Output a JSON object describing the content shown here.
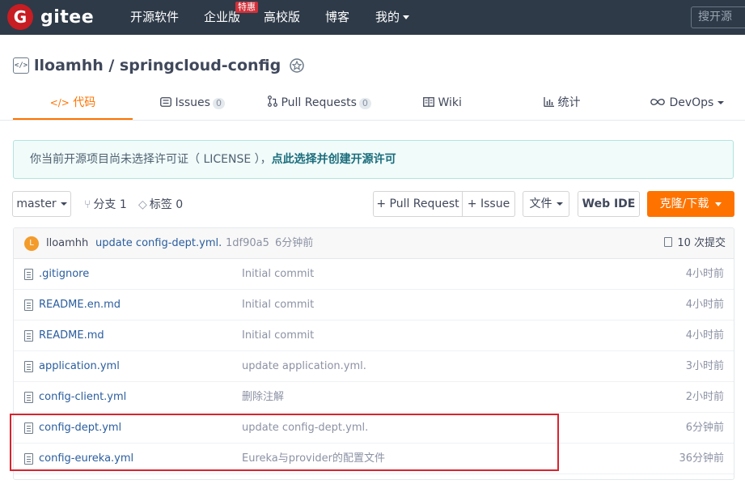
{
  "topnav": {
    "logo_mark": "G",
    "logo_text": "gitee",
    "items": [
      {
        "label": "开源软件"
      },
      {
        "label": "企业版",
        "badge": "特惠"
      },
      {
        "label": "高校版"
      },
      {
        "label": "博客"
      },
      {
        "label": "我的"
      }
    ],
    "search_text": "搜开源"
  },
  "repo": {
    "code_icon": "</>",
    "title": "lloamhh / springcloud-config"
  },
  "tabs": [
    {
      "icon": "</>",
      "label": "代码",
      "active": true
    },
    {
      "icon": "issues-icon",
      "label": "Issues",
      "count": "0"
    },
    {
      "icon": "pull-request-icon",
      "label": "Pull Requests",
      "count": "0"
    },
    {
      "icon": "book-icon",
      "label": "Wiki"
    },
    {
      "icon": "chart-icon",
      "label": "统计"
    },
    {
      "icon": "infinity-icon",
      "label": "DevOps"
    }
  ],
  "notice": {
    "text": "你当前开源项目尚未选择许可证（ LICENSE ），",
    "link": "点此选择并创建开源许可"
  },
  "toolbar": {
    "branch": "master",
    "branches_label": "分支 1",
    "tags_label": "标签 0",
    "pull_request": "+ Pull Request",
    "issue": "+ Issue",
    "file_menu": "文件",
    "web_ide": "Web IDE",
    "clone": "克隆/下载"
  },
  "latest_commit": {
    "avatar_letter": "L",
    "author": "lloamhh",
    "message": "update config-dept.yml.",
    "sha": "1df90a5",
    "time": "6分钟前",
    "commits_count": "10 次提交"
  },
  "files": [
    {
      "name": ".gitignore",
      "commit": "Initial commit",
      "time": "4小时前"
    },
    {
      "name": "README.en.md",
      "commit": "Initial commit",
      "time": "4小时前"
    },
    {
      "name": "README.md",
      "commit": "Initial commit",
      "time": "4小时前"
    },
    {
      "name": "application.yml",
      "commit": "update application.yml.",
      "time": "3小时前"
    },
    {
      "name": "config-client.yml",
      "commit": "删除注解",
      "time": "2小时前"
    },
    {
      "name": "config-dept.yml",
      "commit": "update config-dept.yml.",
      "time": "6分钟前"
    },
    {
      "name": "config-eureka.yml",
      "commit": "Eureka与provider的配置文件",
      "time": "36分钟前"
    }
  ],
  "colors": {
    "nav_bg": "#2e3a48",
    "accent_orange": "#fe7300",
    "link_blue": "#2a5d9e",
    "highlight_red": "#d9232e"
  }
}
